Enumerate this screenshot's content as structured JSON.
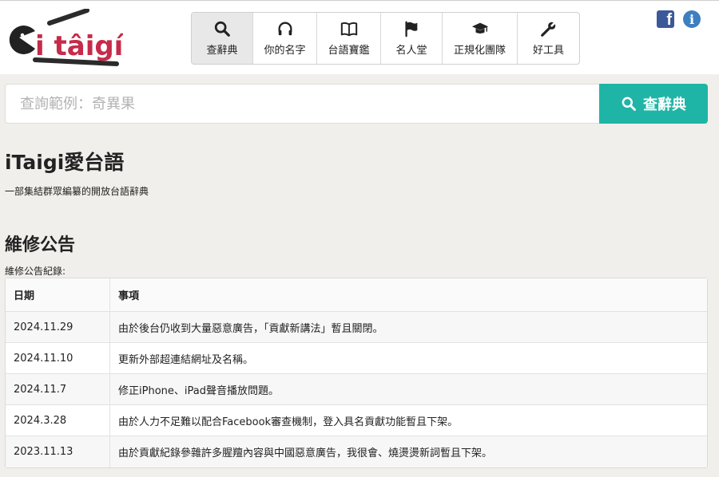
{
  "logo": {
    "text": "i tâigí",
    "icon": "pacman-mascot-icon",
    "accent": "#c62b4a"
  },
  "nav": {
    "items": [
      {
        "label": "查辭典",
        "icon": "search-icon",
        "active": true
      },
      {
        "label": "你的名字",
        "icon": "headphones-icon"
      },
      {
        "label": "台語寶鑑",
        "icon": "book-icon"
      },
      {
        "label": "名人堂",
        "icon": "flag-icon"
      },
      {
        "label": "正規化團隊",
        "icon": "graduation-cap-icon"
      },
      {
        "label": "好工具",
        "icon": "wrench-icon"
      }
    ]
  },
  "social": {
    "facebook": "f",
    "info": "i"
  },
  "search": {
    "placeholder": "查詢範例：奇異果",
    "button_label": "查辭典",
    "button_color": "#1fb5a6"
  },
  "site": {
    "title": "iTaigi愛台語",
    "subtitle": "一部集結群眾編纂的開放台語辭典"
  },
  "announcement": {
    "title": "維修公告",
    "log_label": "維修公告紀錄:",
    "columns": [
      "日期",
      "事項"
    ],
    "rows": [
      {
        "date": "2024.11.29",
        "item": "由於後台仍收到大量惡意廣告，「貢獻新講法」暫且關閉。"
      },
      {
        "date": "2024.11.10",
        "item": "更新外部超連結網址及名稱。"
      },
      {
        "date": "2024.11.7",
        "item": "修正iPhone、iPad聲音播放問題。"
      },
      {
        "date": "2024.3.28",
        "item": "由於人力不足難以配合Facebook審查機制，登入具名貢獻功能暫且下架。"
      },
      {
        "date": "2023.11.13",
        "item": "由於貢獻紀錄參雜許多腥羶內容與中國惡意廣告，我很會、燒燙燙新詞暫且下架。"
      }
    ]
  }
}
